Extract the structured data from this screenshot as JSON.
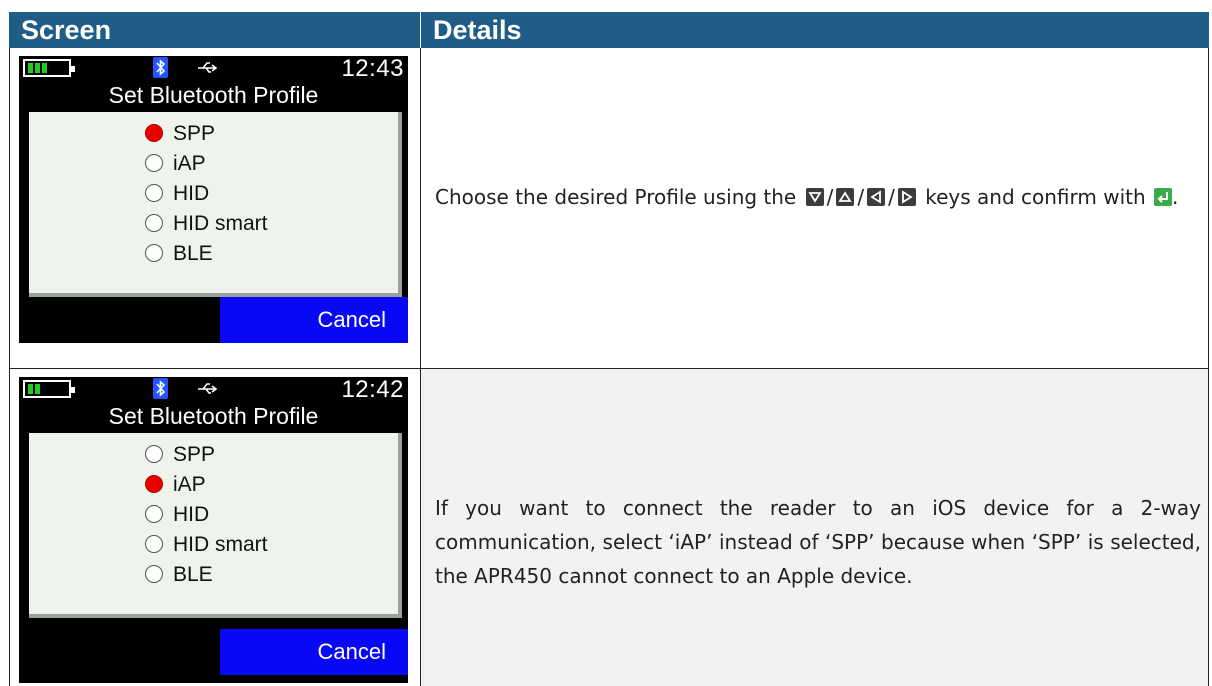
{
  "table": {
    "headers": [
      "Screen",
      "Details"
    ]
  },
  "rows": [
    {
      "screen": {
        "clock": "12:43",
        "title": "Set Bluetooth Profile",
        "options": [
          "SPP",
          "iAP",
          "HID",
          "HID smart",
          "BLE"
        ],
        "selected": "SPP",
        "cancel_label": "Cancel",
        "battery_bars": 3
      },
      "details": {
        "text_before": "Choose the desired Profile using the",
        "keys": [
          "down-key",
          "up-key",
          "left-key",
          "right-key"
        ],
        "separator": "/",
        "text_middle": "keys and confirm with",
        "confirm_key": "enter-key",
        "text_after": "."
      }
    },
    {
      "screen": {
        "clock": "12:42",
        "title": "Set Bluetooth Profile",
        "options": [
          "SPP",
          "iAP",
          "HID",
          "HID smart",
          "BLE"
        ],
        "selected": "iAP",
        "cancel_label": "Cancel",
        "battery_bars": 2
      },
      "details": {
        "text": "If you want to connect the reader to an iOS device for a 2-way communication, select ‘iAP’ instead of ‘SPP’ because when ‘SPP’ is selected, the APR450 cannot connect to an Apple device."
      }
    }
  ],
  "colors": {
    "header_bg": "#1f5c86",
    "alt_row_bg": "#f2f2f2",
    "selected_radio": "#e60000",
    "cancel_bg": "#0808f6",
    "battery": "#22cc22",
    "bluetooth": "#2255ff",
    "confirm_key": "#3aad4a"
  }
}
